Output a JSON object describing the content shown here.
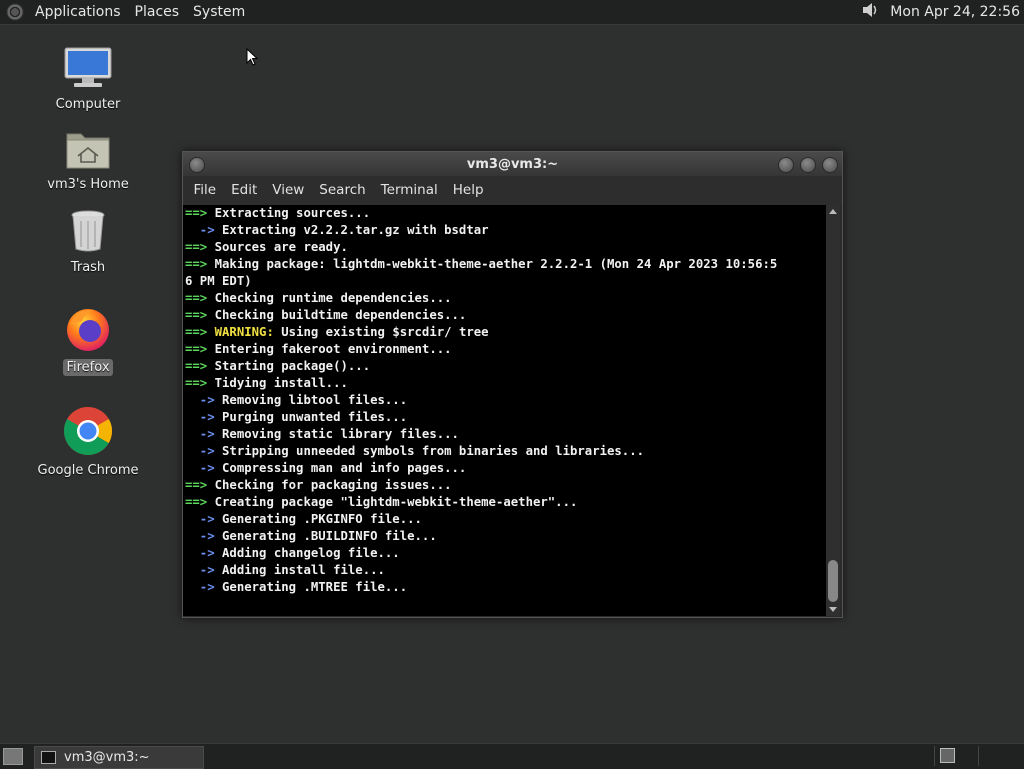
{
  "top_panel": {
    "menus": [
      "Applications",
      "Places",
      "System"
    ],
    "clock": "Mon Apr 24, 22:56"
  },
  "desktop_icons": [
    {
      "label": "Computer",
      "icon": "computer-icon"
    },
    {
      "label": "vm3's Home",
      "icon": "home-folder-icon"
    },
    {
      "label": "Trash",
      "icon": "trash-icon"
    },
    {
      "label": "Firefox",
      "icon": "firefox-icon"
    },
    {
      "label": "Google Chrome",
      "icon": "chrome-icon"
    }
  ],
  "terminal": {
    "title": "vm3@vm3:~",
    "menu": [
      "File",
      "Edit",
      "View",
      "Search",
      "Terminal",
      "Help"
    ],
    "lines": [
      {
        "prefix": "==>",
        "kind": "main",
        "text": " Extracting sources..."
      },
      {
        "prefix": "  ->",
        "kind": "sub",
        "text": " Extracting v2.2.2.tar.gz with bsdtar"
      },
      {
        "prefix": "==>",
        "kind": "main",
        "text": " Sources are ready."
      },
      {
        "prefix": "==>",
        "kind": "main",
        "text": " Making package: lightdm-webkit-theme-aether 2.2.2-1 (Mon 24 Apr 2023 10:56:5"
      },
      {
        "prefix": "",
        "kind": "plain",
        "text": "6 PM EDT)"
      },
      {
        "prefix": "==>",
        "kind": "main",
        "text": " Checking runtime dependencies..."
      },
      {
        "prefix": "==>",
        "kind": "main",
        "text": " Checking buildtime dependencies..."
      },
      {
        "prefix": "==>",
        "kind": "warn",
        "warn": " WARNING:",
        "text": " Using existing $srcdir/ tree"
      },
      {
        "prefix": "==>",
        "kind": "main",
        "text": " Entering fakeroot environment..."
      },
      {
        "prefix": "==>",
        "kind": "main",
        "text": " Starting package()..."
      },
      {
        "prefix": "==>",
        "kind": "main",
        "text": " Tidying install..."
      },
      {
        "prefix": "  ->",
        "kind": "sub",
        "text": " Removing libtool files..."
      },
      {
        "prefix": "  ->",
        "kind": "sub",
        "text": " Purging unwanted files..."
      },
      {
        "prefix": "  ->",
        "kind": "sub",
        "text": " Removing static library files..."
      },
      {
        "prefix": "  ->",
        "kind": "sub",
        "text": " Stripping unneeded symbols from binaries and libraries..."
      },
      {
        "prefix": "  ->",
        "kind": "sub",
        "text": " Compressing man and info pages..."
      },
      {
        "prefix": "==>",
        "kind": "main",
        "text": " Checking for packaging issues..."
      },
      {
        "prefix": "==>",
        "kind": "main",
        "text": " Creating package \"lightdm-webkit-theme-aether\"..."
      },
      {
        "prefix": "  ->",
        "kind": "sub",
        "text": " Generating .PKGINFO file..."
      },
      {
        "prefix": "  ->",
        "kind": "sub",
        "text": " Generating .BUILDINFO file..."
      },
      {
        "prefix": "  ->",
        "kind": "sub",
        "text": " Adding changelog file..."
      },
      {
        "prefix": "  ->",
        "kind": "sub",
        "text": " Adding install file..."
      },
      {
        "prefix": "  ->",
        "kind": "sub",
        "text": " Generating .MTREE file..."
      }
    ]
  },
  "taskbar": {
    "window_button": "vm3@vm3:~"
  },
  "colors": {
    "arrow_main": "#5cd65c",
    "arrow_sub": "#6d8ff0",
    "warning": "#f0e040"
  }
}
